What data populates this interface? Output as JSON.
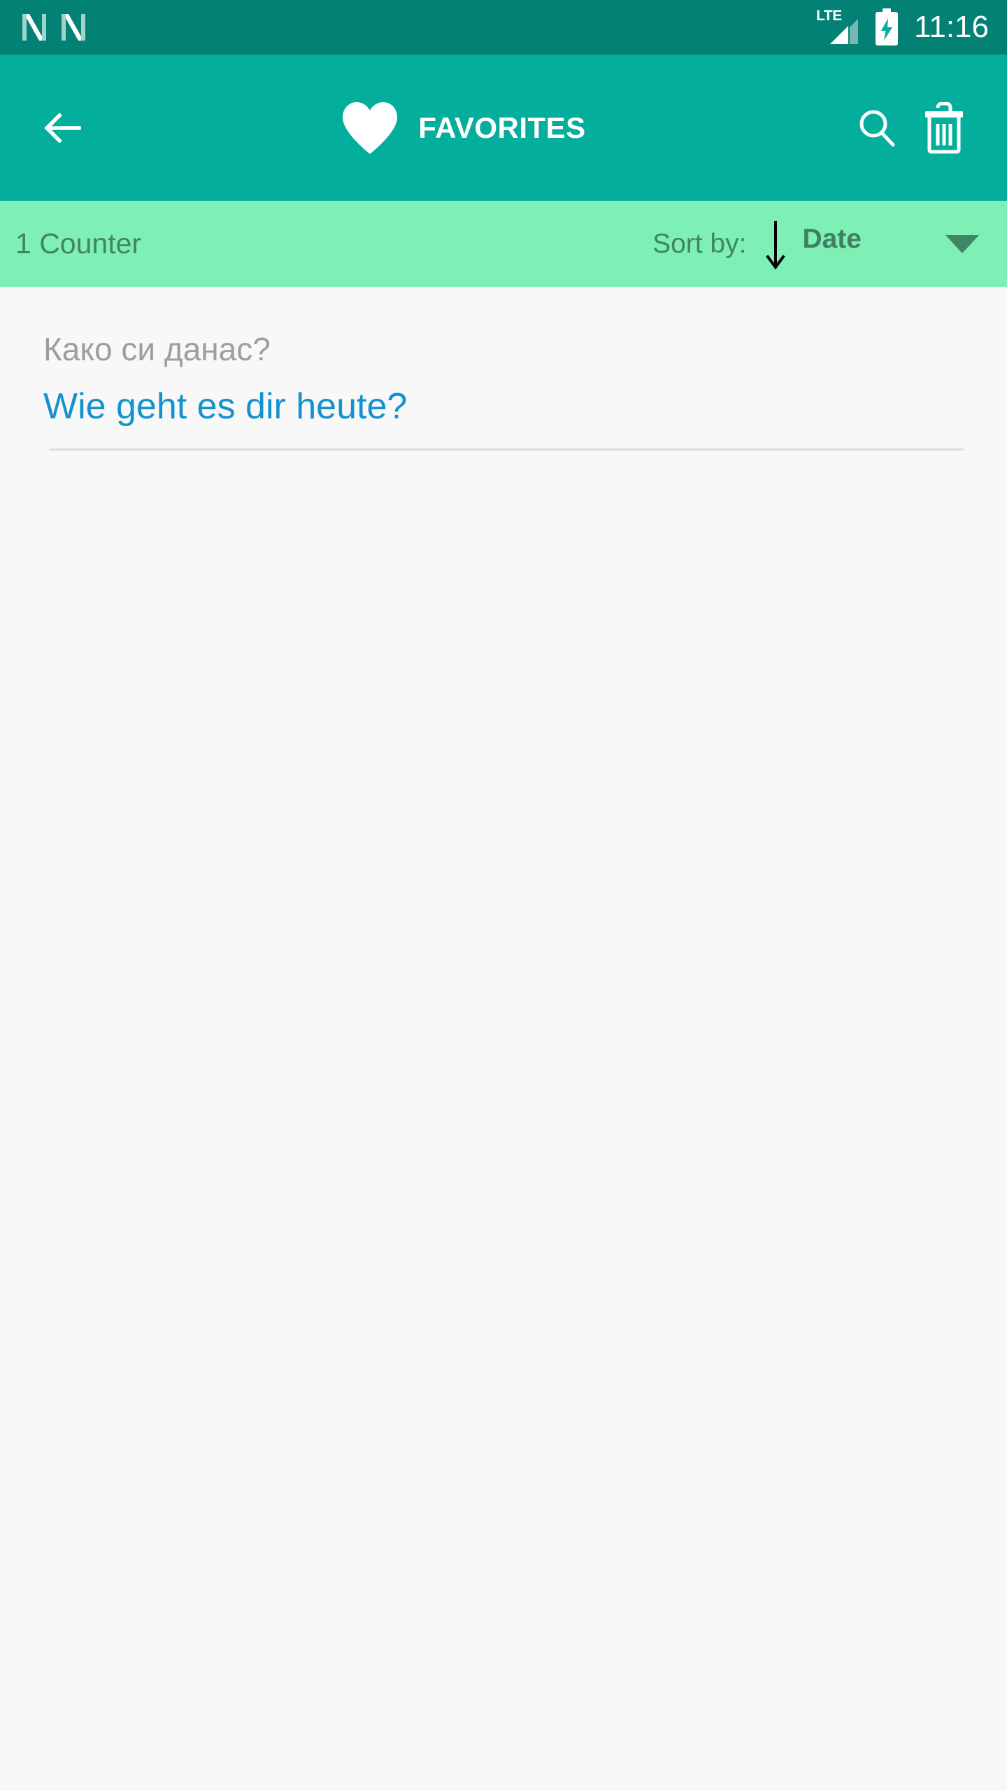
{
  "status_bar": {
    "notification_icons": [
      "nougat-icon",
      "nougat-icon"
    ],
    "network_label": "LTE",
    "signal_icon": "signal-bars-icon",
    "battery_icon": "battery-charging-icon",
    "time": "11:16",
    "background_color": "#028174",
    "foreground_color": "#ffffff"
  },
  "app_bar": {
    "back_icon": "back-arrow-icon",
    "heart_icon": "heart-filled-icon",
    "title": "FAVORITES",
    "search_icon": "search-icon",
    "delete_icon": "trash-icon",
    "background_color": "#04ae9c",
    "foreground_color": "#ffffff"
  },
  "sort_bar": {
    "counter_label": "1 Counter",
    "sort_by_label": "Sort by:",
    "sort_direction_icon": "arrow-down-icon",
    "sort_value": "Date",
    "dropdown_icon": "caret-down-icon",
    "background_color": "#7ff0b5",
    "text_color": "#3f8664"
  },
  "list": {
    "items": [
      {
        "source_text": "Како си данас?",
        "target_text": "Wie geht es dir heute?",
        "source_color": "#9e9e9e",
        "target_color": "#1492ce"
      }
    ]
  }
}
